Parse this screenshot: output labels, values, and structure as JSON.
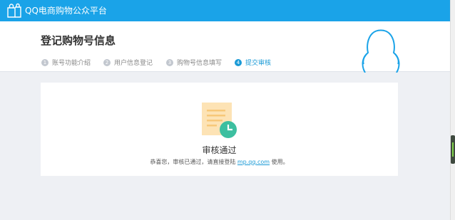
{
  "topbar": {
    "brand_name": "QQ电商购物公众平台"
  },
  "header": {
    "title": "登记购物号信息",
    "steps": [
      {
        "num": "1",
        "label": "账号功能介绍"
      },
      {
        "num": "2",
        "label": "用户信息登记"
      },
      {
        "num": "3",
        "label": "购物号信息填写"
      },
      {
        "num": "4",
        "label": "提交审核"
      }
    ],
    "active_step": 4
  },
  "result": {
    "title": "审核通过",
    "desc_prefix": "恭喜您，审核已通过，请直接登陆",
    "link": "mp.qq.com",
    "desc_suffix": "使用。"
  },
  "colors": {
    "brand": "#1aa3e8",
    "accent": "#1a9ad6",
    "success": "#3dbfa0"
  },
  "icons": {
    "brand": "shopping-bags-icon",
    "mascot": "qq-penguin-icon",
    "status": "document-clock-icon"
  }
}
